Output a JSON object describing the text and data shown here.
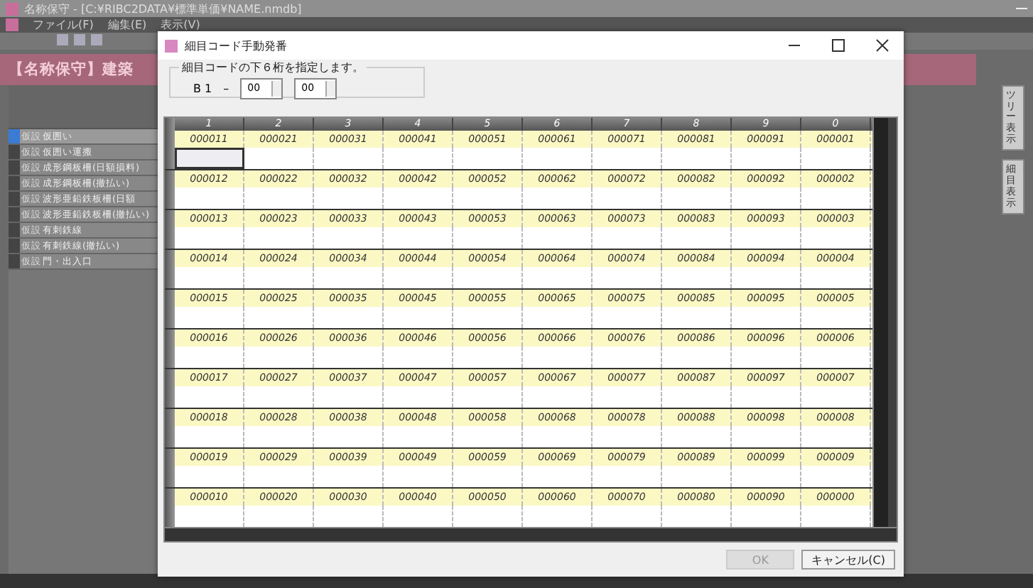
{
  "main_window": {
    "title": "名称保守 - [C:¥RIBC2DATA¥標準単価¥NAME.nmdb]",
    "menu": [
      "ファイル(F)",
      "編集(E)",
      "表示(V)"
    ],
    "banner": "【名称保守】建築",
    "side_tabs": [
      "ツリー表示",
      "細目表示"
    ],
    "items": [
      {
        "code": "仮設",
        "name": "仮囲い",
        "selected": true
      },
      {
        "code": "仮設",
        "name": "仮囲い運搬",
        "selected": false
      },
      {
        "code": "仮設",
        "name": "成形鋼板柵(日額損料)",
        "selected": false
      },
      {
        "code": "仮設",
        "name": "成形鋼板柵(撤払い)",
        "selected": false
      },
      {
        "code": "仮設",
        "name": "波形亜鉛鉄板柵(日額",
        "selected": false
      },
      {
        "code": "仮設",
        "name": "波形亜鉛鉄板柵(撤払い)",
        "selected": false
      },
      {
        "code": "仮設",
        "name": "有刺鉄線",
        "selected": false
      },
      {
        "code": "仮設",
        "name": "有刺鉄線(撤払い)",
        "selected": false
      },
      {
        "code": "仮設",
        "name": "門・出入口",
        "selected": false
      }
    ]
  },
  "dialog": {
    "title": "細目コード手動発番",
    "group_label": "細目コードの下６桁を指定します。",
    "prefix": "B 1",
    "dash": "–",
    "spin1": "00",
    "spin2": "00",
    "columns": [
      "1",
      "2",
      "3",
      "4",
      "5",
      "6",
      "7",
      "8",
      "9",
      "0"
    ],
    "rows": [
      {
        "codes": [
          "000011",
          "000021",
          "000031",
          "000041",
          "000051",
          "000061",
          "000071",
          "000081",
          "000091",
          "000001"
        ],
        "focused": [
          true,
          false,
          false,
          false,
          false,
          false,
          false,
          false,
          false,
          false
        ]
      },
      {
        "codes": [
          "000012",
          "000022",
          "000032",
          "000042",
          "000052",
          "000062",
          "000072",
          "000082",
          "000092",
          "000002"
        ],
        "focused": [
          false,
          false,
          false,
          false,
          false,
          false,
          false,
          false,
          false,
          false
        ]
      },
      {
        "codes": [
          "000013",
          "000023",
          "000033",
          "000043",
          "000053",
          "000063",
          "000073",
          "000083",
          "000093",
          "000003"
        ],
        "focused": [
          false,
          false,
          false,
          false,
          false,
          false,
          false,
          false,
          false,
          false
        ]
      },
      {
        "codes": [
          "000014",
          "000024",
          "000034",
          "000044",
          "000054",
          "000064",
          "000074",
          "000084",
          "000094",
          "000004"
        ],
        "focused": [
          false,
          false,
          false,
          false,
          false,
          false,
          false,
          false,
          false,
          false
        ]
      },
      {
        "codes": [
          "000015",
          "000025",
          "000035",
          "000045",
          "000055",
          "000065",
          "000075",
          "000085",
          "000095",
          "000005"
        ],
        "focused": [
          false,
          false,
          false,
          false,
          false,
          false,
          false,
          false,
          false,
          false
        ]
      },
      {
        "codes": [
          "000016",
          "000026",
          "000036",
          "000046",
          "000056",
          "000066",
          "000076",
          "000086",
          "000096",
          "000006"
        ],
        "focused": [
          false,
          false,
          false,
          false,
          false,
          false,
          false,
          false,
          false,
          false
        ]
      },
      {
        "codes": [
          "000017",
          "000027",
          "000037",
          "000047",
          "000057",
          "000067",
          "000077",
          "000087",
          "000097",
          "000007"
        ],
        "focused": [
          false,
          false,
          false,
          false,
          false,
          false,
          false,
          false,
          false,
          false
        ]
      },
      {
        "codes": [
          "000018",
          "000028",
          "000038",
          "000048",
          "000058",
          "000068",
          "000078",
          "000088",
          "000098",
          "000008"
        ],
        "focused": [
          false,
          false,
          false,
          false,
          false,
          false,
          false,
          false,
          false,
          false
        ]
      },
      {
        "codes": [
          "000019",
          "000029",
          "000039",
          "000049",
          "000059",
          "000069",
          "000079",
          "000089",
          "000099",
          "000009"
        ],
        "focused": [
          false,
          false,
          false,
          false,
          false,
          false,
          false,
          false,
          false,
          false
        ]
      },
      {
        "codes": [
          "000010",
          "000020",
          "000030",
          "000040",
          "000050",
          "000060",
          "000070",
          "000080",
          "000090",
          "000000"
        ],
        "focused": [
          false,
          false,
          false,
          false,
          false,
          false,
          false,
          false,
          false,
          false
        ]
      }
    ],
    "ok": {
      "label": "OK",
      "disabled": true
    },
    "cancel": {
      "label": "キャンセル(C)",
      "disabled": false
    }
  }
}
